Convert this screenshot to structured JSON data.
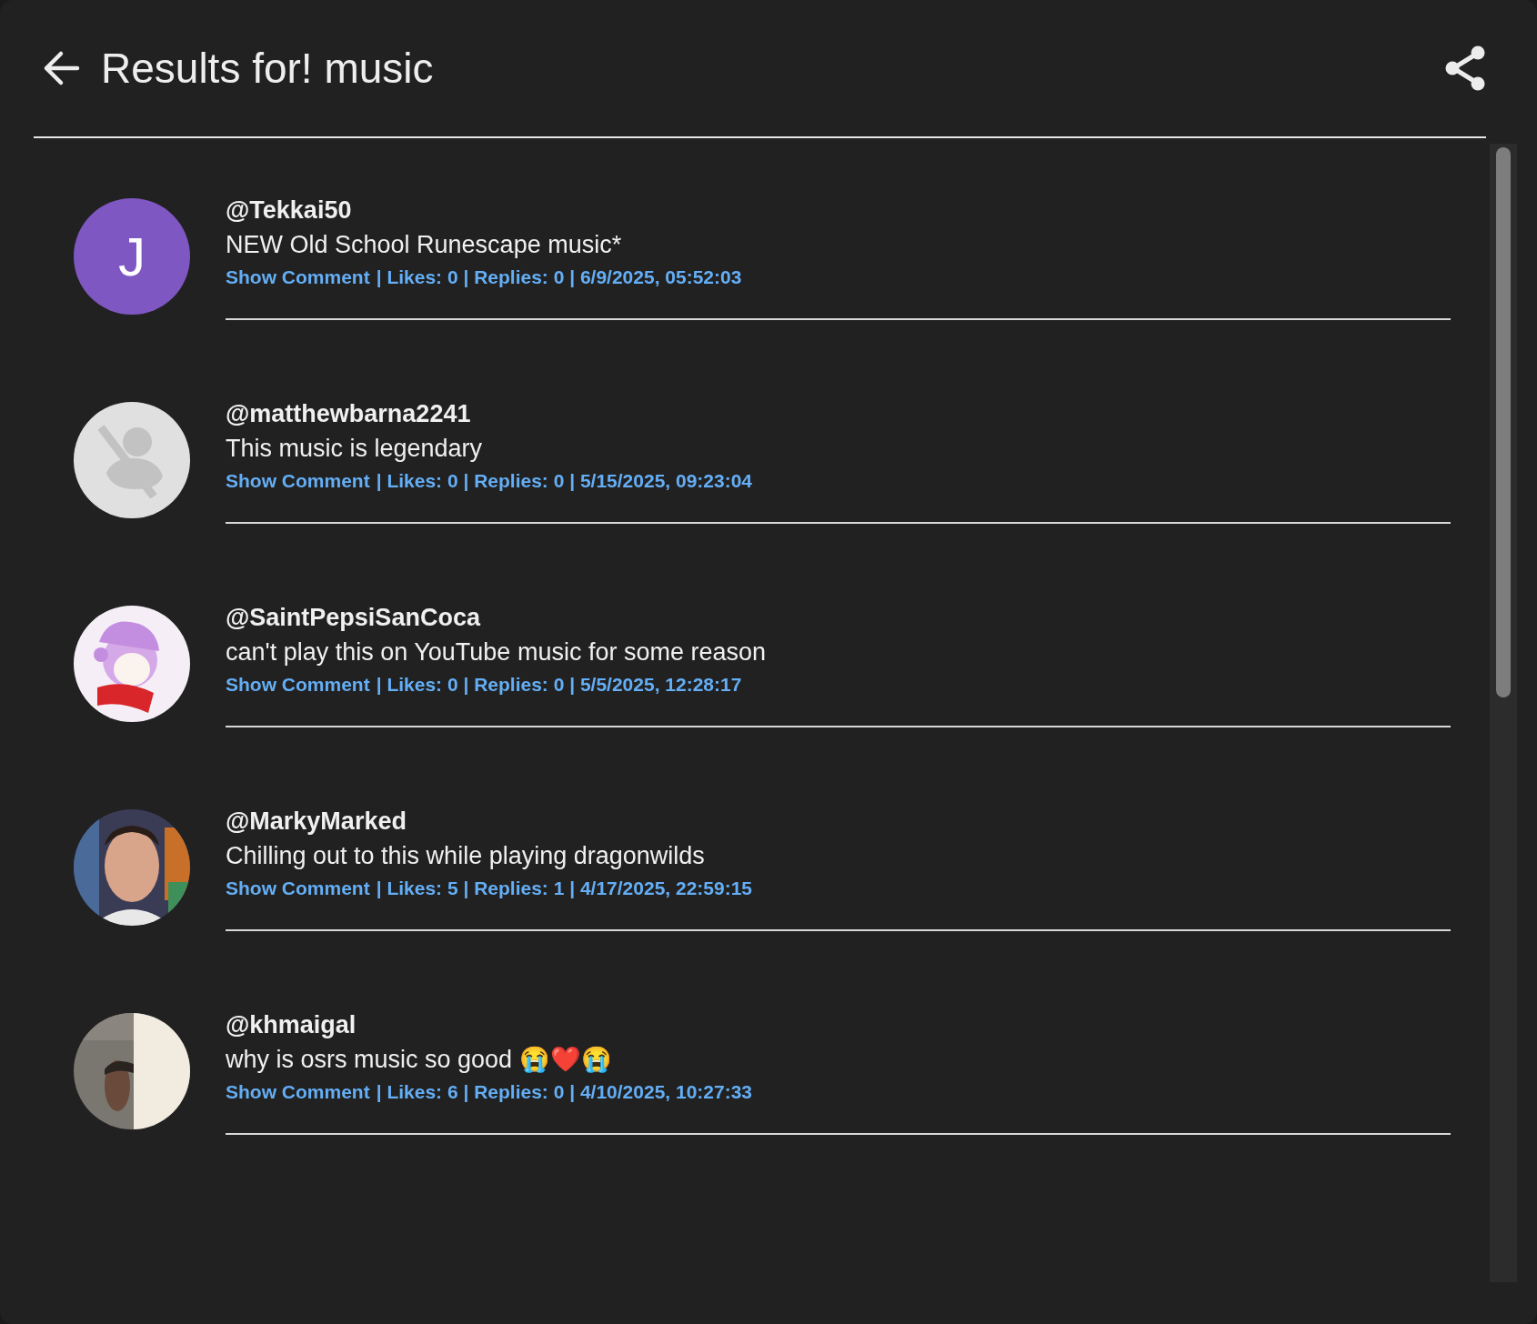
{
  "header": {
    "title": "Results for! music"
  },
  "comments": [
    {
      "username": "@Tekkai50",
      "text": "NEW Old School Runescape music*",
      "link": "Show Comment",
      "stats": "| Likes: 0 | Replies: 0 | 6/9/2025, 05:52:03",
      "avatar": {
        "kind": "letter",
        "letter": "J",
        "color": "#7e57c2"
      }
    },
    {
      "username": "@matthewbarna2241",
      "text": "This music is legendary",
      "link": "Show Comment",
      "stats": "| Likes: 0 | Replies: 0 | 5/15/2025, 09:23:04",
      "avatar": {
        "kind": "default"
      }
    },
    {
      "username": "@SaintPepsiSanCoca",
      "text": "can't play this on YouTube music for some reason",
      "link": "Show Comment",
      "stats": "| Likes: 0 | Replies: 0 | 5/5/2025, 12:28:17"
    },
    {
      "username": "@MarkyMarked",
      "text": "Chilling out to this while playing dragonwilds",
      "link": "Show Comment",
      "stats": "| Likes: 5 | Replies: 1 | 4/17/2025, 22:59:15"
    },
    {
      "username": "@khmaigal",
      "text": "why is osrs music so good 😭❤️😭",
      "link": "Show Comment",
      "stats": "| Likes: 6 | Replies: 0 | 4/10/2025, 10:27:33"
    }
  ]
}
